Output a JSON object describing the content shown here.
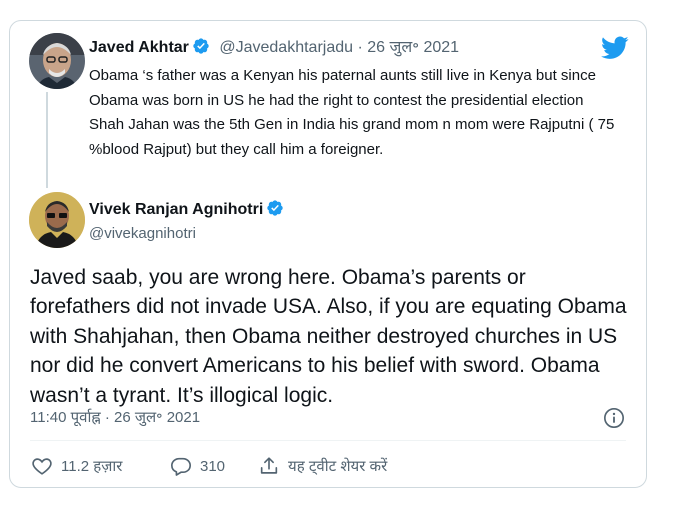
{
  "parent_tweet": {
    "name": "Javed Akhtar",
    "handle": "@Javedakhtarjadu",
    "separator": " · ",
    "date": "26 जुल॰ 2021",
    "text": "Obama ‘s father was a Kenyan his paternal  aunts still live in Kenya but since  Obama was born in US he had the right to contest the presidential election Shah Jahan was the 5th Gen in India his grand mom n mom were Rajputni ( 75 %blood Rajput) but they call him a foreigner."
  },
  "main_tweet": {
    "name": "Vivek Ranjan Agnihotri",
    "handle": "@vivekagnihotri",
    "text": "Javed saab, you are wrong here. Obama’s parents or forefathers did not invade USA. Also, if you are equating Obama with Shahjahan, then Obama neither destroyed churches in US nor did he convert Americans to his belief with sword. Obama wasn’t a tyrant. It’s illogical logic.",
    "timestamp": "11:40 पूर्वाह्न · 26 जुल॰ 2021"
  },
  "actions": {
    "likes": "11.2 हज़ार",
    "replies": "310",
    "share": "यह ट्वीट शेयर करें"
  },
  "icons": {
    "brand": "twitter-bird-icon",
    "verified": "verified-badge-icon",
    "info": "info-icon",
    "like": "heart-icon",
    "reply": "reply-bubble-icon",
    "share": "share-icon"
  },
  "colors": {
    "brand_blue": "#1d9bf0",
    "text": "#0f1419",
    "secondary": "#536471",
    "border": "#cfd9de"
  }
}
